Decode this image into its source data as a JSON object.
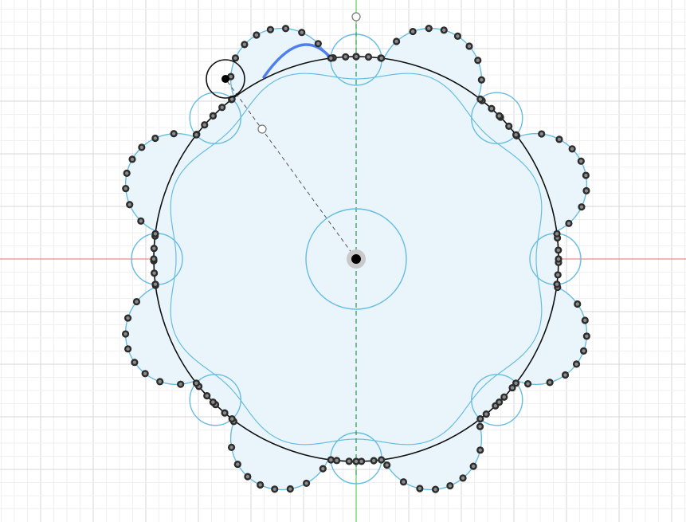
{
  "colors": {
    "background": "#ffffff",
    "grid_minor": "#eef0f2",
    "grid_major": "#d3d7dc",
    "axis_x": "#ef6b6b",
    "axis_y": "#3bc43b",
    "sketch_fill": "#eaf5fb",
    "sketch_line": "#67bde0",
    "construction_circle": "#111111",
    "selected_arc": "#4d7ff1",
    "point_outer": "#2c2c2c",
    "point_inner": "#8a8a8a",
    "dashed_line": "#555555",
    "centerline": "#2f8f4f"
  },
  "sketch": {
    "lobe_count": 8,
    "tools": [
      "construction-circle",
      "lobe-arc",
      "inner-notch-arc",
      "center-circle",
      "dimension-line",
      "origin-point"
    ],
    "selected_entity": "lobe-arc"
  },
  "icons": [
    "origin-point-icon",
    "sketch-point-icon",
    "drag-handle-icon",
    "constraint-handle-icon"
  ]
}
